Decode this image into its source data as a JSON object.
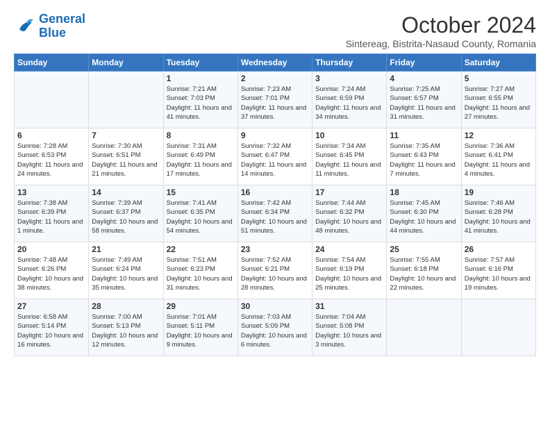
{
  "logo": {
    "line1": "General",
    "line2": "Blue"
  },
  "title": "October 2024",
  "subtitle": "Sintereag, Bistrita-Nasaud County, Romania",
  "headers": [
    "Sunday",
    "Monday",
    "Tuesday",
    "Wednesday",
    "Thursday",
    "Friday",
    "Saturday"
  ],
  "weeks": [
    [
      {
        "day": "",
        "info": ""
      },
      {
        "day": "",
        "info": ""
      },
      {
        "day": "1",
        "info": "Sunrise: 7:21 AM\nSunset: 7:03 PM\nDaylight: 11 hours and 41 minutes."
      },
      {
        "day": "2",
        "info": "Sunrise: 7:23 AM\nSunset: 7:01 PM\nDaylight: 11 hours and 37 minutes."
      },
      {
        "day": "3",
        "info": "Sunrise: 7:24 AM\nSunset: 6:59 PM\nDaylight: 11 hours and 34 minutes."
      },
      {
        "day": "4",
        "info": "Sunrise: 7:25 AM\nSunset: 6:57 PM\nDaylight: 11 hours and 31 minutes."
      },
      {
        "day": "5",
        "info": "Sunrise: 7:27 AM\nSunset: 6:55 PM\nDaylight: 11 hours and 27 minutes."
      }
    ],
    [
      {
        "day": "6",
        "info": "Sunrise: 7:28 AM\nSunset: 6:53 PM\nDaylight: 11 hours and 24 minutes."
      },
      {
        "day": "7",
        "info": "Sunrise: 7:30 AM\nSunset: 6:51 PM\nDaylight: 11 hours and 21 minutes."
      },
      {
        "day": "8",
        "info": "Sunrise: 7:31 AM\nSunset: 6:49 PM\nDaylight: 11 hours and 17 minutes."
      },
      {
        "day": "9",
        "info": "Sunrise: 7:32 AM\nSunset: 6:47 PM\nDaylight: 11 hours and 14 minutes."
      },
      {
        "day": "10",
        "info": "Sunrise: 7:34 AM\nSunset: 6:45 PM\nDaylight: 11 hours and 11 minutes."
      },
      {
        "day": "11",
        "info": "Sunrise: 7:35 AM\nSunset: 6:43 PM\nDaylight: 11 hours and 7 minutes."
      },
      {
        "day": "12",
        "info": "Sunrise: 7:36 AM\nSunset: 6:41 PM\nDaylight: 11 hours and 4 minutes."
      }
    ],
    [
      {
        "day": "13",
        "info": "Sunrise: 7:38 AM\nSunset: 6:39 PM\nDaylight: 11 hours and 1 minute."
      },
      {
        "day": "14",
        "info": "Sunrise: 7:39 AM\nSunset: 6:37 PM\nDaylight: 10 hours and 58 minutes."
      },
      {
        "day": "15",
        "info": "Sunrise: 7:41 AM\nSunset: 6:35 PM\nDaylight: 10 hours and 54 minutes."
      },
      {
        "day": "16",
        "info": "Sunrise: 7:42 AM\nSunset: 6:34 PM\nDaylight: 10 hours and 51 minutes."
      },
      {
        "day": "17",
        "info": "Sunrise: 7:44 AM\nSunset: 6:32 PM\nDaylight: 10 hours and 48 minutes."
      },
      {
        "day": "18",
        "info": "Sunrise: 7:45 AM\nSunset: 6:30 PM\nDaylight: 10 hours and 44 minutes."
      },
      {
        "day": "19",
        "info": "Sunrise: 7:46 AM\nSunset: 6:28 PM\nDaylight: 10 hours and 41 minutes."
      }
    ],
    [
      {
        "day": "20",
        "info": "Sunrise: 7:48 AM\nSunset: 6:26 PM\nDaylight: 10 hours and 38 minutes."
      },
      {
        "day": "21",
        "info": "Sunrise: 7:49 AM\nSunset: 6:24 PM\nDaylight: 10 hours and 35 minutes."
      },
      {
        "day": "22",
        "info": "Sunrise: 7:51 AM\nSunset: 6:23 PM\nDaylight: 10 hours and 31 minutes."
      },
      {
        "day": "23",
        "info": "Sunrise: 7:52 AM\nSunset: 6:21 PM\nDaylight: 10 hours and 28 minutes."
      },
      {
        "day": "24",
        "info": "Sunrise: 7:54 AM\nSunset: 6:19 PM\nDaylight: 10 hours and 25 minutes."
      },
      {
        "day": "25",
        "info": "Sunrise: 7:55 AM\nSunset: 6:18 PM\nDaylight: 10 hours and 22 minutes."
      },
      {
        "day": "26",
        "info": "Sunrise: 7:57 AM\nSunset: 6:16 PM\nDaylight: 10 hours and 19 minutes."
      }
    ],
    [
      {
        "day": "27",
        "info": "Sunrise: 6:58 AM\nSunset: 5:14 PM\nDaylight: 10 hours and 16 minutes."
      },
      {
        "day": "28",
        "info": "Sunrise: 7:00 AM\nSunset: 5:13 PM\nDaylight: 10 hours and 12 minutes."
      },
      {
        "day": "29",
        "info": "Sunrise: 7:01 AM\nSunset: 5:11 PM\nDaylight: 10 hours and 9 minutes."
      },
      {
        "day": "30",
        "info": "Sunrise: 7:03 AM\nSunset: 5:09 PM\nDaylight: 10 hours and 6 minutes."
      },
      {
        "day": "31",
        "info": "Sunrise: 7:04 AM\nSunset: 5:08 PM\nDaylight: 10 hours and 3 minutes."
      },
      {
        "day": "",
        "info": ""
      },
      {
        "day": "",
        "info": ""
      }
    ]
  ]
}
